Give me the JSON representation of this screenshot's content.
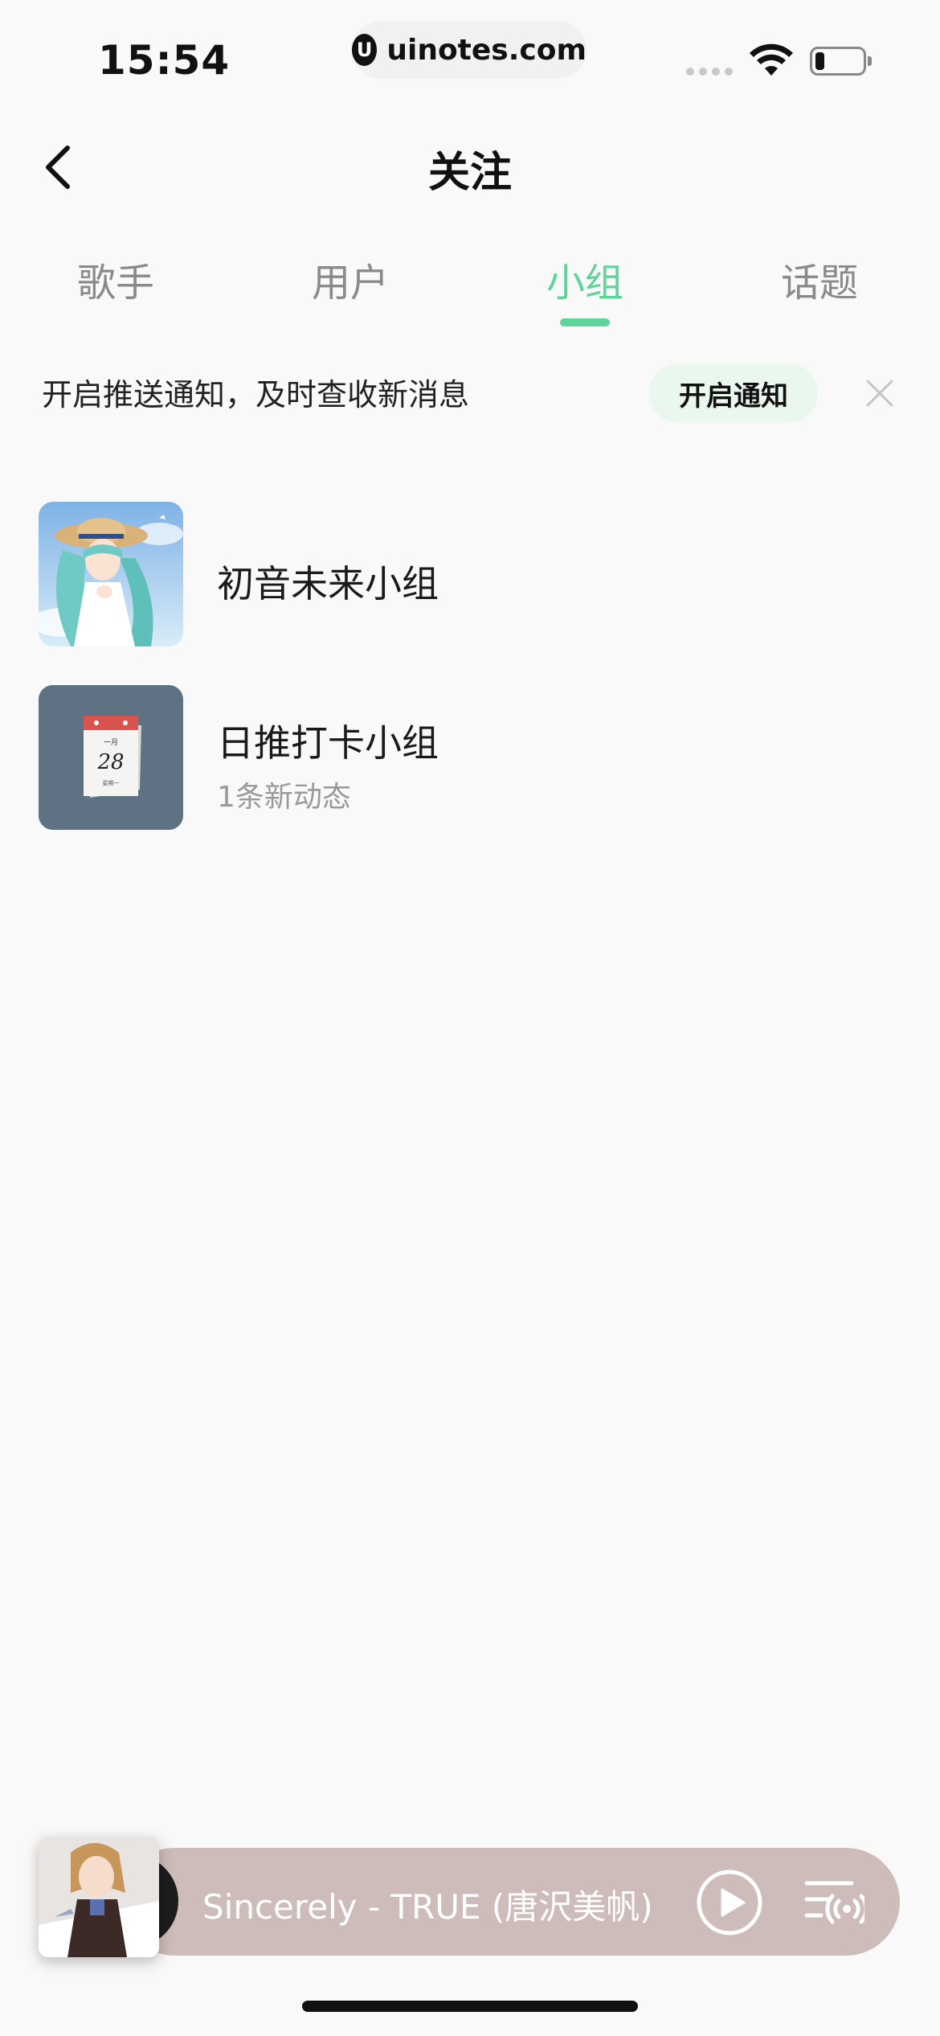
{
  "status_bar": {
    "time": "15:54",
    "url_logo": "U",
    "url": "uinotes.com",
    "battery_level": 0.2
  },
  "nav": {
    "back_icon": "chevron-left-icon",
    "title": "关注"
  },
  "tabs": [
    {
      "label": "歌手",
      "active": false
    },
    {
      "label": "用户",
      "active": false
    },
    {
      "label": "小组",
      "active": true
    },
    {
      "label": "话题",
      "active": false
    }
  ],
  "notice": {
    "text": "开启推送通知，及时查收新消息",
    "button_label": "开启通知",
    "close_icon": "close-icon"
  },
  "groups": [
    {
      "name": "初音未来小组",
      "subtitle": ""
    },
    {
      "name": "日推打卡小组",
      "subtitle": "1条新动态",
      "calendar_month": "一月",
      "calendar_day": "28",
      "calendar_weekday": "星期一"
    }
  ],
  "player": {
    "title": "Sincerely - TRUE (唐沢美帆)",
    "play_icon": "play-icon",
    "playlist_icon": "playlist-radio-icon"
  },
  "colors": {
    "accent": "#5ed39a",
    "notice_button_bg": "#e9f7ee",
    "player_bg": "#cdbcb9",
    "background": "#f9f9f9"
  }
}
